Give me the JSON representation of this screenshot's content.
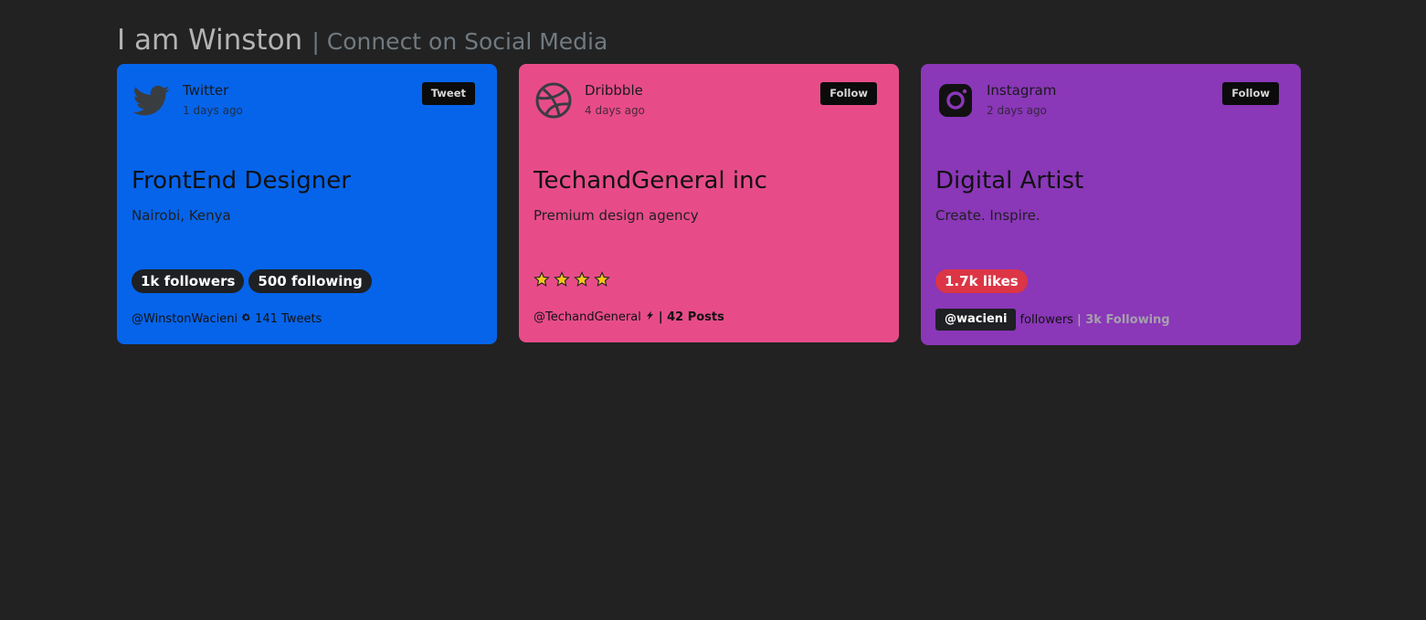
{
  "header": {
    "name": "I am Winston",
    "subtitle": "| Connect on Social Media"
  },
  "cards": [
    {
      "platform": "Twitter",
      "time": "1 days ago",
      "action": "Tweet",
      "title": "FrontEnd Designer",
      "subtitle": "Nairobi, Kenya",
      "badges": [
        "1k followers",
        "500 following"
      ],
      "footer": {
        "handle": "@WinstonWacieni",
        "separator_icon": "gear-icon",
        "stat": "141 Tweets"
      },
      "icon": "twitter-bird-icon",
      "background": "#0664ea"
    },
    {
      "platform": "Dribbble",
      "time": "4 days ago",
      "action": "Follow",
      "title": "TechandGeneral inc",
      "subtitle": "Premium design agency",
      "rating": 4,
      "footer": {
        "handle": "@TechandGeneral",
        "separator_icon": "lightning-icon",
        "stat": "| 42 Posts"
      },
      "icon": "dribbble-icon",
      "background": "#e74c89"
    },
    {
      "platform": "Instagram",
      "time": "2 days ago",
      "action": "Follow",
      "title": "Digital Artist",
      "subtitle": "Create. Inspire.",
      "badges": [
        "1.7k likes"
      ],
      "footer": {
        "handle": "@wacieni",
        "followers": "followers",
        "stat": "| 3k Following"
      },
      "icon": "instagram-icon",
      "background": "#8a37b8"
    }
  ]
}
